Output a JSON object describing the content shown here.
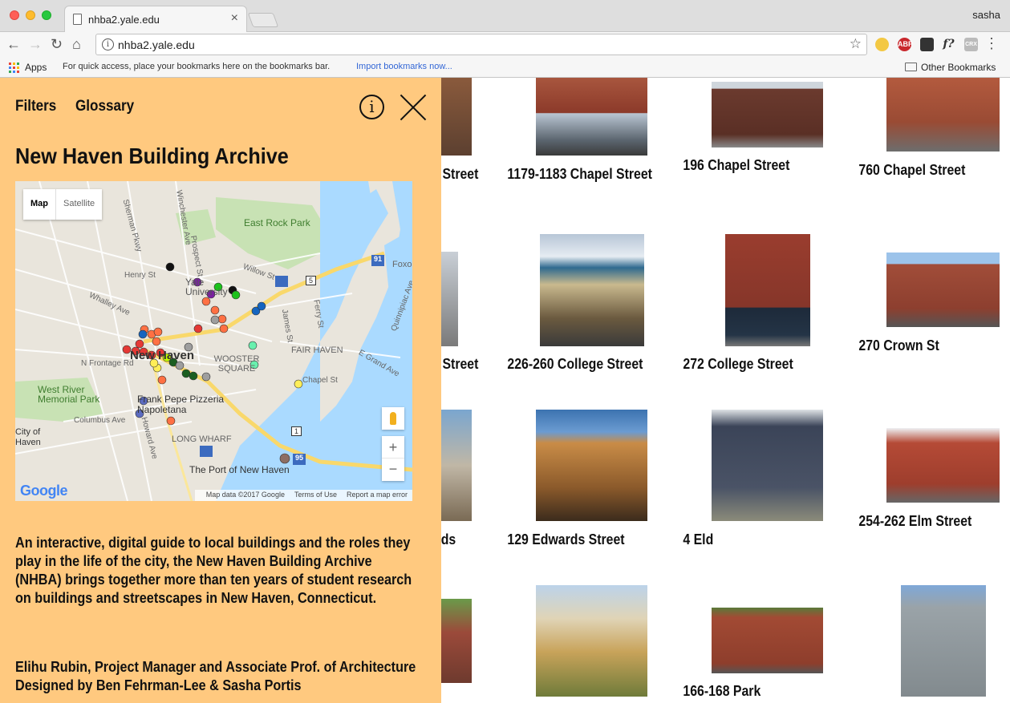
{
  "browser": {
    "tab_title": "nhba2.yale.edu",
    "tab_close": "×",
    "profile": "sasha",
    "url": "nhba2.yale.edu",
    "back": "←",
    "forward": "→",
    "reload": "↻",
    "home": "⌂",
    "star": "☆",
    "menu": "⋮",
    "info": "i",
    "ext_abp": "ABP",
    "ext_f": "f?",
    "ext_crx": "CRX",
    "bookmarks": {
      "apps": "Apps",
      "hint": "For quick access, place your bookmarks here on the bookmarks bar.",
      "import": "Import bookmarks now...",
      "other": "Other Bookmarks"
    }
  },
  "panel": {
    "filters": "Filters",
    "glossary": "Glossary",
    "info_glyph": "i",
    "title": "New Haven Building Archive",
    "description": "An interactive, digital guide to local buildings and the roles they play in the life of the city, the  New Haven Building Archive (NHBA) brings together more than ten years of student research on buildings and streetscapes in New Haven, Connecticut.",
    "credit_1": "Elihu Rubin, Project Manager and Associate Prof. of Architecture",
    "credit_2": "Designed by Ben Fehrman-Lee & Sasha Portis"
  },
  "map": {
    "type_map": "Map",
    "type_satellite": "Satellite",
    "zoom_in": "+",
    "zoom_out": "−",
    "logo": "Google",
    "footer": [
      "Map data ©2017 Google",
      "Terms of Use",
      "Report a map error"
    ],
    "labels": {
      "east_rock": "East Rock Park",
      "yale": "Yale University",
      "new_haven": "New Haven",
      "wooster": "WOOSTER SQUARE",
      "fair_haven": "FAIR HAVEN",
      "west_river": "West River Memorial Park",
      "pepe": "Frank Pepe Pizzeria Napoletana",
      "long_wharf": "LONG WHARF",
      "port": "The Port of New Haven",
      "city_of": "City of Haven",
      "whalley": "Whalley Ave",
      "columbus": "Columbus Ave",
      "frontage": "N Frontage Rd",
      "henry": "Henry St",
      "willow": "Willow St",
      "james": "James St",
      "ferry": "Ferry St",
      "grand": "E Grand Ave",
      "chapel": "Chapel St",
      "winchester": "Winchester Ave",
      "prospect": "Prospect St",
      "sherman_pkwy": "Sherman Pkwy",
      "howard": "Howard Ave",
      "foxon": "Foxon",
      "quinnipiac": "Quinnipiac Ave",
      "i91": "91",
      "i95": "95",
      "r1": "1",
      "r5": "5"
    }
  },
  "buildings": [
    {
      "caption": "Street"
    },
    {
      "caption": "1179-1183 Chapel Street"
    },
    {
      "caption": "196 Chapel Street"
    },
    {
      "caption": "760 Chapel Street"
    },
    {
      "caption": "Street"
    },
    {
      "caption": "226-260 College Street"
    },
    {
      "caption": "272 College Street"
    },
    {
      "caption": "270 Crown St"
    },
    {
      "caption": "ds"
    },
    {
      "caption": "129 Edwards Street"
    },
    {
      "caption": "4 Eld"
    },
    {
      "caption": "254-262 Elm Street"
    },
    {
      "caption": ""
    },
    {
      "caption": ""
    },
    {
      "caption": "166-168 Park"
    },
    {
      "caption": ""
    }
  ]
}
